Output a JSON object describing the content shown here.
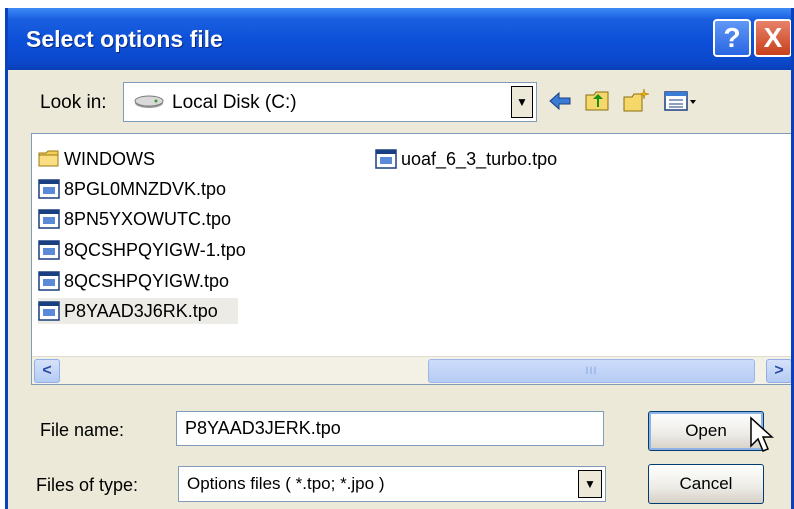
{
  "dialog": {
    "title": "Select options file",
    "help_label": "?",
    "close_label": "X"
  },
  "toolbar": {
    "look_in_label": "Look in:",
    "look_in_value": "Local Disk (C:)",
    "tools": [
      "back-icon",
      "up-folder-icon",
      "new-folder-icon",
      "view-menu-icon"
    ]
  },
  "file_list": {
    "items": [
      {
        "name": "WINDOWS",
        "type": "folder"
      },
      {
        "name": "8PGL0MNZDVK.tpo",
        "type": "file"
      },
      {
        "name": "8PN5YXOWUTC.tpo",
        "type": "file"
      },
      {
        "name": "8QCSHPQYIGW-1.tpo",
        "type": "file"
      },
      {
        "name": "8QCSHPQYIGW.tpo",
        "type": "file"
      },
      {
        "name": "P8YAAD3J6RK.tpo",
        "type": "file",
        "selected": true
      },
      {
        "name": "uoaf_6_3_turbo.tpo",
        "type": "file"
      }
    ],
    "scroll_left": "<",
    "scroll_right": ">",
    "scroll_thumb": "III"
  },
  "form": {
    "file_name_label": "File name:",
    "file_name_value": "P8YAAD3JERK.tpo",
    "file_type_label": "Files of type:",
    "file_type_value": "Options files ( *.tpo; *.jpo )"
  },
  "buttons": {
    "open_label": "Open",
    "cancel_label": "Cancel"
  }
}
